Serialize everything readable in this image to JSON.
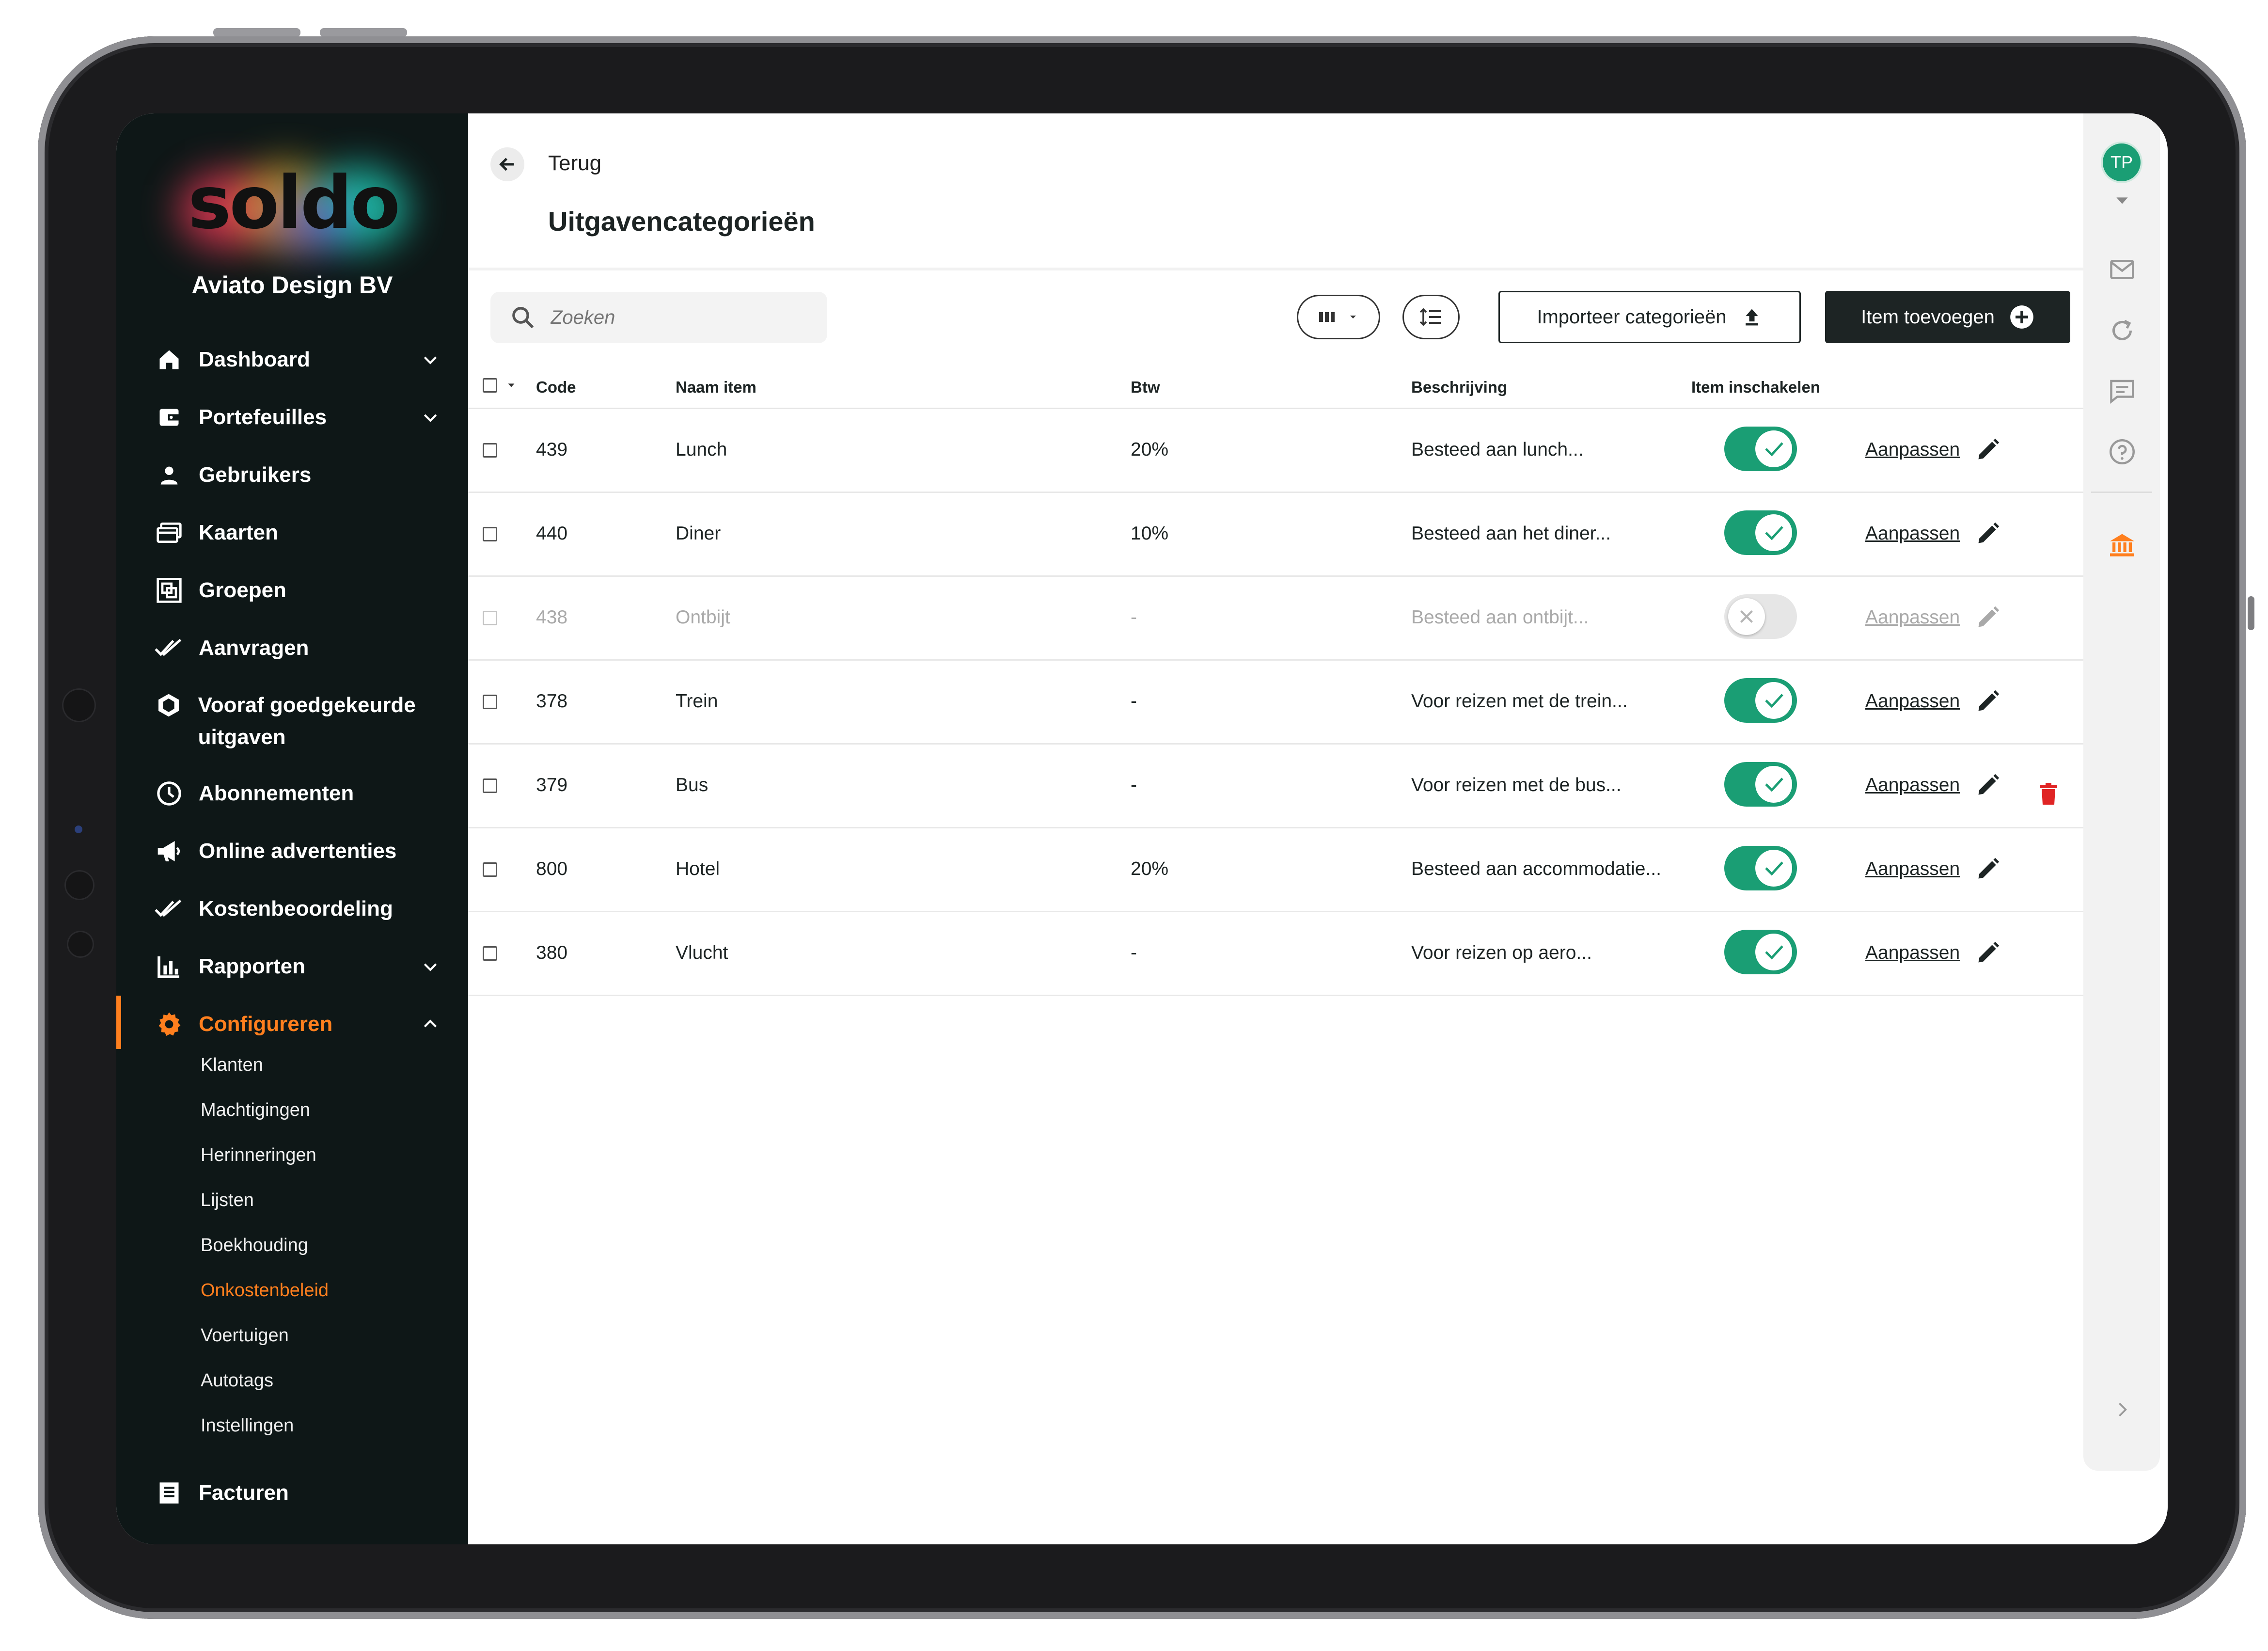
{
  "sidebar": {
    "company": "Aviato Design BV",
    "logo_text": "soldo",
    "nav": [
      {
        "label": "Dashboard"
      },
      {
        "label": "Portefeuilles"
      },
      {
        "label": "Gebruikers"
      },
      {
        "label": "Kaarten"
      },
      {
        "label": "Groepen"
      },
      {
        "label": "Aanvragen"
      },
      {
        "label": "Vooraf goedgekeurde uitgaven"
      },
      {
        "label": "Abonnementen"
      },
      {
        "label": "Online advertenties"
      },
      {
        "label": "Kostenbeoordeling"
      },
      {
        "label": "Rapporten"
      },
      {
        "label": "Configureren"
      },
      {
        "label": "Facturen"
      }
    ],
    "sub": [
      "Klanten",
      "Machtigingen",
      "Herinneringen",
      "Lijsten",
      "Boekhouding",
      "Onkostenbeleid",
      "Voertuigen",
      "Autotags",
      "Instellingen"
    ]
  },
  "header": {
    "back_label": "Terug",
    "title": "Uitgavencategorieën"
  },
  "toolbar": {
    "search_placeholder": "Zoeken",
    "import_label": "Importeer categorieën",
    "add_label": "Item toevoegen"
  },
  "table": {
    "columns": [
      "Code",
      "Naam item",
      "Btw",
      "Beschrijving",
      "Item inschakelen"
    ],
    "edit_label": "Aanpassen",
    "rows": [
      {
        "code": "439",
        "name": "Lunch",
        "vat": "20%",
        "desc": "Besteed aan lunch...",
        "enabled": true
      },
      {
        "code": "440",
        "name": "Diner",
        "vat": "10%",
        "desc": "Besteed aan het diner...",
        "enabled": true
      },
      {
        "code": "438",
        "name": "Ontbijt",
        "vat": "-",
        "desc": "Besteed aan ontbijt...",
        "enabled": false
      },
      {
        "code": "378",
        "name": "Trein",
        "vat": "-",
        "desc": "Voor reizen met de trein...",
        "enabled": true
      },
      {
        "code": "379",
        "name": "Bus",
        "vat": "-",
        "desc": "Voor reizen met de bus...",
        "enabled": true
      },
      {
        "code": "800",
        "name": "Hotel",
        "vat": "20%",
        "desc": "Besteed aan accommodatie...",
        "enabled": true
      },
      {
        "code": "380",
        "name": "Vlucht",
        "vat": "-",
        "desc": "Voor reizen op aero...",
        "enabled": true
      }
    ]
  },
  "rail": {
    "avatar_initials": "TP"
  },
  "colors": {
    "accent": "#ff7f1e",
    "toggle_on": "#1a9e74",
    "sidebar_bg": "#0e1717",
    "danger": "#e02424"
  }
}
